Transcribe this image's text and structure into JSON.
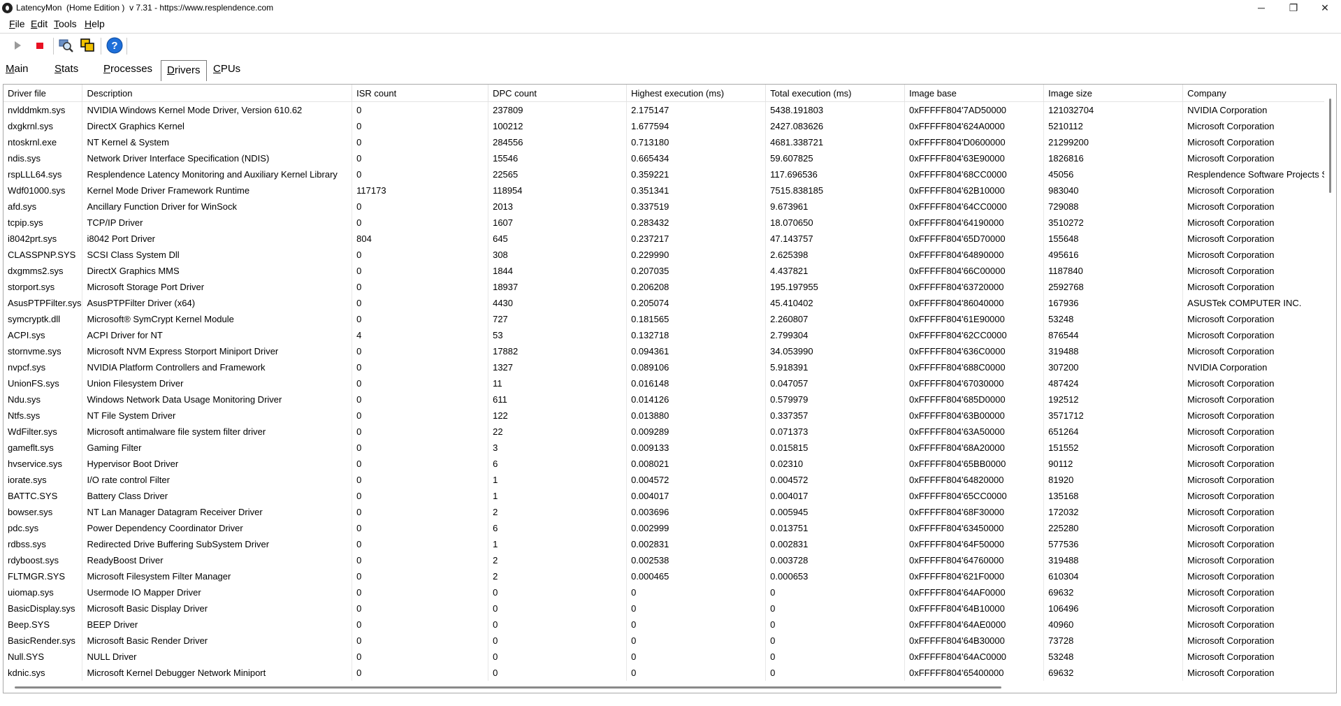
{
  "window": {
    "title": "LatencyMon  (Home Edition )  v 7.31 - https://www.resplendence.com",
    "minimize": "─",
    "maximize": "❐",
    "close": "✕"
  },
  "menu": {
    "file": {
      "acc": "F",
      "rest": "ile"
    },
    "edit": {
      "acc": "E",
      "rest": "dit"
    },
    "tools": {
      "acc": "T",
      "rest": "ools"
    },
    "help": {
      "acc": "H",
      "rest": "elp"
    }
  },
  "toolbar": {
    "icons": [
      "play-icon",
      "stop-icon",
      "search-icon",
      "copy-windows-icon",
      "help-icon"
    ],
    "colors": {
      "stop": "#e81123",
      "help": "#1e6fd9"
    }
  },
  "tabs": [
    {
      "acc": "M",
      "rest": "ain",
      "active": false
    },
    {
      "acc": "S",
      "rest": "tats",
      "active": false
    },
    {
      "acc": "P",
      "rest": "rocesses",
      "active": false
    },
    {
      "acc": "D",
      "rest": "rivers",
      "active": true
    },
    {
      "acc": "C",
      "rest": "PUs",
      "active": false
    }
  ],
  "drivers_table": {
    "columns": [
      "Driver file",
      "Description",
      "ISR count",
      "DPC count",
      "Highest execution (ms)",
      "Total execution (ms)",
      "Image base",
      "Image size",
      "Company"
    ],
    "rows": [
      [
        "nvlddmkm.sys",
        "NVIDIA Windows Kernel Mode Driver, Version 610.62",
        "0",
        "237809",
        "2.175147",
        "5438.191803",
        "0xFFFFF804'7AD50000",
        "121032704",
        "NVIDIA Corporation"
      ],
      [
        "dxgkrnl.sys",
        "DirectX Graphics Kernel",
        "0",
        "100212",
        "1.677594",
        "2427.083626",
        "0xFFFFF804'624A0000",
        "5210112",
        "Microsoft Corporation"
      ],
      [
        "ntoskrnl.exe",
        "NT Kernel & System",
        "0",
        "284556",
        "0.713180",
        "4681.338721",
        "0xFFFFF804'D0600000",
        "21299200",
        "Microsoft Corporation"
      ],
      [
        "ndis.sys",
        "Network Driver Interface Specification (NDIS)",
        "0",
        "15546",
        "0.665434",
        "59.607825",
        "0xFFFFF804'63E90000",
        "1826816",
        "Microsoft Corporation"
      ],
      [
        "rspLLL64.sys",
        "Resplendence Latency Monitoring and Auxiliary Kernel Library",
        "0",
        "22565",
        "0.359221",
        "117.696536",
        "0xFFFFF804'68CC0000",
        "45056",
        "Resplendence Software Projects Sp."
      ],
      [
        "Wdf01000.sys",
        "Kernel Mode Driver Framework Runtime",
        "117173",
        "118954",
        "0.351341",
        "7515.838185",
        "0xFFFFF804'62B10000",
        "983040",
        "Microsoft Corporation"
      ],
      [
        "afd.sys",
        "Ancillary Function Driver for WinSock",
        "0",
        "2013",
        "0.337519",
        "9.673961",
        "0xFFFFF804'64CC0000",
        "729088",
        "Microsoft Corporation"
      ],
      [
        "tcpip.sys",
        "TCP/IP Driver",
        "0",
        "1607",
        "0.283432",
        "18.070650",
        "0xFFFFF804'64190000",
        "3510272",
        "Microsoft Corporation"
      ],
      [
        "i8042prt.sys",
        "i8042 Port Driver",
        "804",
        "645",
        "0.237217",
        "47.143757",
        "0xFFFFF804'65D70000",
        "155648",
        "Microsoft Corporation"
      ],
      [
        "CLASSPNP.SYS",
        "SCSI Class System Dll",
        "0",
        "308",
        "0.229990",
        "2.625398",
        "0xFFFFF804'64890000",
        "495616",
        "Microsoft Corporation"
      ],
      [
        "dxgmms2.sys",
        "DirectX Graphics MMS",
        "0",
        "1844",
        "0.207035",
        "4.437821",
        "0xFFFFF804'66C00000",
        "1187840",
        "Microsoft Corporation"
      ],
      [
        "storport.sys",
        "Microsoft Storage Port Driver",
        "0",
        "18937",
        "0.206208",
        "195.197955",
        "0xFFFFF804'63720000",
        "2592768",
        "Microsoft Corporation"
      ],
      [
        "AsusPTPFilter.sys",
        "AsusPTPFilter Driver (x64)",
        "0",
        "4430",
        "0.205074",
        "45.410402",
        "0xFFFFF804'86040000",
        "167936",
        "ASUSTek COMPUTER INC."
      ],
      [
        "symcryptk.dll",
        "Microsoft® SymCrypt Kernel Module",
        "0",
        "727",
        "0.181565",
        "2.260807",
        "0xFFFFF804'61E90000",
        "53248",
        "Microsoft Corporation"
      ],
      [
        "ACPI.sys",
        "ACPI Driver for NT",
        "4",
        "53",
        "0.132718",
        "2.799304",
        "0xFFFFF804'62CC0000",
        "876544",
        "Microsoft Corporation"
      ],
      [
        "stornvme.sys",
        "Microsoft NVM Express Storport Miniport Driver",
        "0",
        "17882",
        "0.094361",
        "34.053990",
        "0xFFFFF804'636C0000",
        "319488",
        "Microsoft Corporation"
      ],
      [
        "nvpcf.sys",
        "NVIDIA Platform Controllers and Framework",
        "0",
        "1327",
        "0.089106",
        "5.918391",
        "0xFFFFF804'688C0000",
        "307200",
        "NVIDIA Corporation"
      ],
      [
        "UnionFS.sys",
        "Union Filesystem Driver",
        "0",
        "11",
        "0.016148",
        "0.047057",
        "0xFFFFF804'67030000",
        "487424",
        "Microsoft Corporation"
      ],
      [
        "Ndu.sys",
        "Windows Network Data Usage Monitoring Driver",
        "0",
        "611",
        "0.014126",
        "0.579979",
        "0xFFFFF804'685D0000",
        "192512",
        "Microsoft Corporation"
      ],
      [
        "Ntfs.sys",
        "NT File System Driver",
        "0",
        "122",
        "0.013880",
        "0.337357",
        "0xFFFFF804'63B00000",
        "3571712",
        "Microsoft Corporation"
      ],
      [
        "WdFilter.sys",
        "Microsoft antimalware file system filter driver",
        "0",
        "22",
        "0.009289",
        "0.071373",
        "0xFFFFF804'63A50000",
        "651264",
        "Microsoft Corporation"
      ],
      [
        "gameflt.sys",
        "Gaming Filter",
        "0",
        "3",
        "0.009133",
        "0.015815",
        "0xFFFFF804'68A20000",
        "151552",
        "Microsoft Corporation"
      ],
      [
        "hvservice.sys",
        "Hypervisor Boot Driver",
        "0",
        "6",
        "0.008021",
        "0.02310",
        "0xFFFFF804'65BB0000",
        "90112",
        "Microsoft Corporation"
      ],
      [
        "iorate.sys",
        "I/O rate control Filter",
        "0",
        "1",
        "0.004572",
        "0.004572",
        "0xFFFFF804'64820000",
        "81920",
        "Microsoft Corporation"
      ],
      [
        "BATTC.SYS",
        "Battery Class Driver",
        "0",
        "1",
        "0.004017",
        "0.004017",
        "0xFFFFF804'65CC0000",
        "135168",
        "Microsoft Corporation"
      ],
      [
        "bowser.sys",
        "NT Lan Manager Datagram Receiver Driver",
        "0",
        "2",
        "0.003696",
        "0.005945",
        "0xFFFFF804'68F30000",
        "172032",
        "Microsoft Corporation"
      ],
      [
        "pdc.sys",
        "Power Dependency Coordinator Driver",
        "0",
        "6",
        "0.002999",
        "0.013751",
        "0xFFFFF804'63450000",
        "225280",
        "Microsoft Corporation"
      ],
      [
        "rdbss.sys",
        "Redirected Drive Buffering SubSystem Driver",
        "0",
        "1",
        "0.002831",
        "0.002831",
        "0xFFFFF804'64F50000",
        "577536",
        "Microsoft Corporation"
      ],
      [
        "rdyboost.sys",
        "ReadyBoost Driver",
        "0",
        "2",
        "0.002538",
        "0.003728",
        "0xFFFFF804'64760000",
        "319488",
        "Microsoft Corporation"
      ],
      [
        "FLTMGR.SYS",
        "Microsoft Filesystem Filter Manager",
        "0",
        "2",
        "0.000465",
        "0.000653",
        "0xFFFFF804'621F0000",
        "610304",
        "Microsoft Corporation"
      ],
      [
        "uiomap.sys",
        "Usermode IO Mapper Driver",
        "0",
        "0",
        "0",
        "0",
        "0xFFFFF804'64AF0000",
        "69632",
        "Microsoft Corporation"
      ],
      [
        "BasicDisplay.sys",
        "Microsoft Basic Display Driver",
        "0",
        "0",
        "0",
        "0",
        "0xFFFFF804'64B10000",
        "106496",
        "Microsoft Corporation"
      ],
      [
        "Beep.SYS",
        "BEEP Driver",
        "0",
        "0",
        "0",
        "0",
        "0xFFFFF804'64AE0000",
        "40960",
        "Microsoft Corporation"
      ],
      [
        "BasicRender.sys",
        "Microsoft Basic Render Driver",
        "0",
        "0",
        "0",
        "0",
        "0xFFFFF804'64B30000",
        "73728",
        "Microsoft Corporation"
      ],
      [
        "Null.SYS",
        "NULL Driver",
        "0",
        "0",
        "0",
        "0",
        "0xFFFFF804'64AC0000",
        "53248",
        "Microsoft Corporation"
      ],
      [
        "kdnic.sys",
        "Microsoft Kernel Debugger Network Miniport",
        "0",
        "0",
        "0",
        "0",
        "0xFFFFF804'65400000",
        "69632",
        "Microsoft Corporation"
      ]
    ]
  }
}
